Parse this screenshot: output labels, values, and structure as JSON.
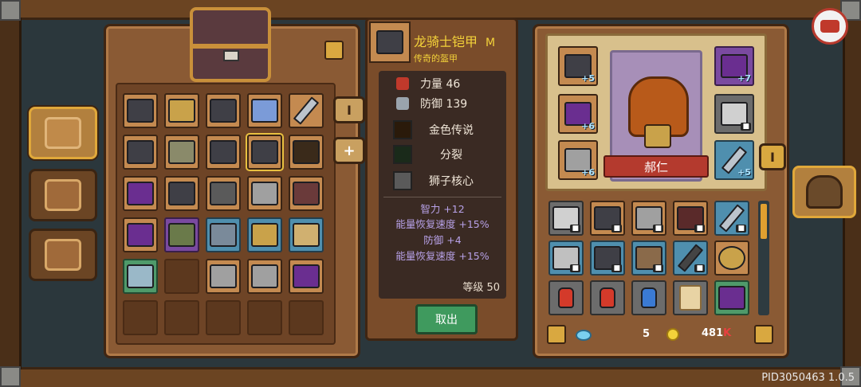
{
  "item": {
    "name": "龙骑士铠甲",
    "tier": "M",
    "subtitle": "传奇的盔甲",
    "stats": [
      {
        "label": "力量 46",
        "icon": "fist-icon",
        "color": "#c0392b"
      },
      {
        "label": "防御 139",
        "icon": "shield-icon",
        "color": "#9aa4ad"
      }
    ],
    "traits": [
      {
        "label": "金色传说",
        "icon": "gold-flame-icon"
      },
      {
        "label": "分裂",
        "icon": "split-arrows-icon"
      },
      {
        "label": "狮子核心",
        "icon": "lion-core-icon"
      }
    ],
    "bonuses": [
      "智力 +12",
      "能量恢复速度 +15%",
      "防御 +4",
      "能量恢复速度 +15%"
    ],
    "level": "等级 50",
    "take_out_label": "取出"
  },
  "character": {
    "name": "郝仁",
    "equip_plus": [
      "+5",
      "+6",
      "+6",
      "+7",
      "+5"
    ]
  },
  "sidebar": {
    "tabs": [
      {
        "name": "chest-tab",
        "active": true
      },
      {
        "name": "codex-tab",
        "active": false
      },
      {
        "name": "exchange-tab",
        "active": false
      }
    ]
  },
  "left_controls": {
    "toggle_label": "I",
    "add_label": "+"
  },
  "right_controls": {
    "toggle_label": "I"
  },
  "currency": {
    "gems": "5",
    "gold": "481",
    "gold_suffix": "K"
  },
  "version": "PID3050463 1.0.5",
  "colors": {
    "rare_purple": "#7a4aa0",
    "rare_teal": "#4f8fae",
    "rare_green": "#4f9a6a",
    "legendary_gold": "#e8c040"
  }
}
